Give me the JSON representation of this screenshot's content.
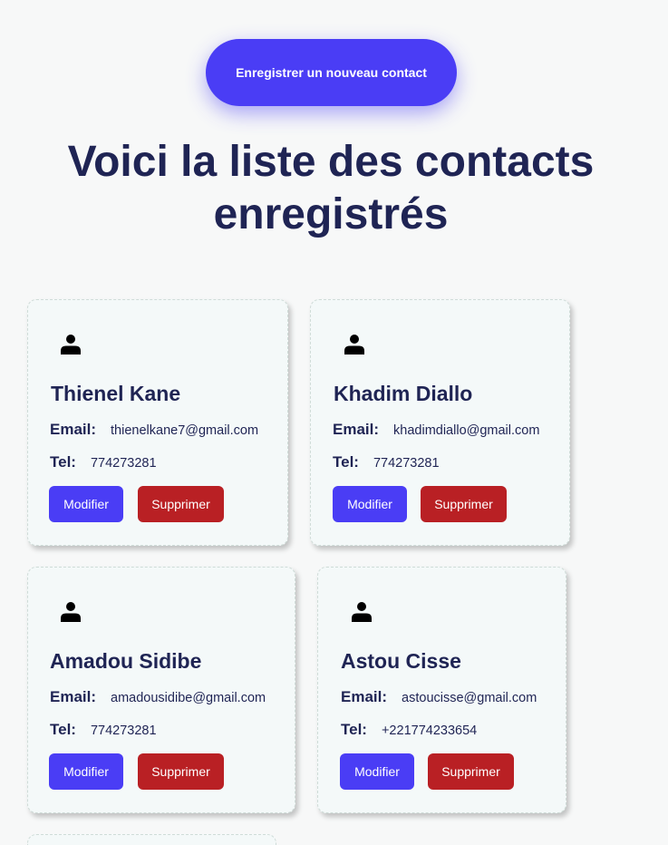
{
  "header": {
    "register_button_label": "Enregistrer un nouveau contact",
    "title": "Voici la liste des contacts enregistrés"
  },
  "labels": {
    "email": "Email:",
    "tel": "Tel:",
    "edit": "Modifier",
    "delete": "Supprimer"
  },
  "contacts": [
    {
      "name": "Thienel Kane",
      "email": "thienelkane7@gmail.com",
      "tel": "774273281"
    },
    {
      "name": "Khadim Diallo",
      "email": "khadimdiallo@gmail.com",
      "tel": "774273281"
    },
    {
      "name": "Amadou Sidibe",
      "email": "amadousidibe@gmail.com",
      "tel": "774273281"
    },
    {
      "name": "Astou Cisse",
      "email": "astoucisse@gmail.com",
      "tel": "+221774233654"
    }
  ],
  "icons": {
    "contact": "person-icon"
  },
  "colors": {
    "accent": "#4a3df5",
    "danger": "#b92024",
    "text": "#1f2454",
    "card_background": "#f4f9f9",
    "page_background": "#f7f8f8"
  }
}
